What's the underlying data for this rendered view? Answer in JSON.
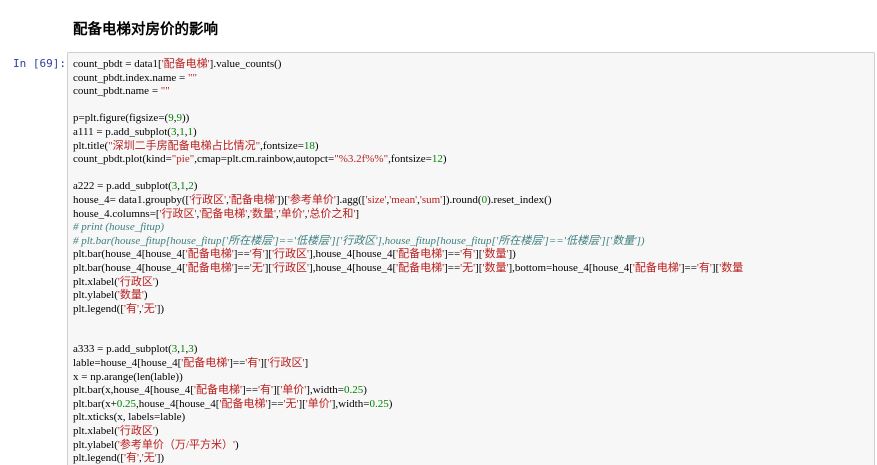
{
  "heading": "配备电梯对房价的影响",
  "cell": {
    "prompt": "In  [69]:",
    "lines": [
      [
        [
          "count_pbdt = data1[",
          ""
        ],
        [
          "'配备电梯'",
          "s"
        ],
        [
          "].value_counts()",
          ""
        ]
      ],
      [
        [
          "count_pbdt.index.name = ",
          ""
        ],
        [
          "\"\"",
          "s"
        ]
      ],
      [
        [
          "count_pbdt.name = ",
          ""
        ],
        [
          "\"\"",
          "s"
        ]
      ],
      [],
      [
        [
          "p=plt.figure(figsize=(",
          ""
        ],
        [
          "9",
          "n"
        ],
        [
          ",",
          ""
        ],
        [
          "9",
          "n"
        ],
        [
          "))",
          ""
        ]
      ],
      [
        [
          "a111 = p.add_subplot(",
          ""
        ],
        [
          "3",
          "n"
        ],
        [
          ",",
          ""
        ],
        [
          "1",
          "n"
        ],
        [
          ",",
          ""
        ],
        [
          "1",
          "n"
        ],
        [
          ")",
          ""
        ]
      ],
      [
        [
          "plt.title(",
          ""
        ],
        [
          "\"深圳二手房配备电梯占比情况\"",
          "s"
        ],
        [
          ",fontsize=",
          ""
        ],
        [
          "18",
          "n"
        ],
        [
          ")",
          ""
        ]
      ],
      [
        [
          "count_pbdt.plot(kind=",
          ""
        ],
        [
          "\"pie\"",
          "s"
        ],
        [
          ",cmap=plt.cm.rainbow,autopct=",
          ""
        ],
        [
          "\"%3.2f%%\"",
          "s"
        ],
        [
          ",fontsize=",
          ""
        ],
        [
          "12",
          "n"
        ],
        [
          ")",
          ""
        ]
      ],
      [],
      [
        [
          "a222 = p.add_subplot(",
          ""
        ],
        [
          "3",
          "n"
        ],
        [
          ",",
          ""
        ],
        [
          "1",
          "n"
        ],
        [
          ",",
          ""
        ],
        [
          "2",
          "n"
        ],
        [
          ")",
          ""
        ]
      ],
      [
        [
          "house_4= data1.groupby([",
          ""
        ],
        [
          "'行政区'",
          "s"
        ],
        [
          ",",
          ""
        ],
        [
          "'配备电梯'",
          "s"
        ],
        [
          "])[",
          ""
        ],
        [
          "'参考单价'",
          "s"
        ],
        [
          "].agg([",
          ""
        ],
        [
          "'size'",
          "s"
        ],
        [
          ",",
          ""
        ],
        [
          "'mean'",
          "s"
        ],
        [
          ",",
          ""
        ],
        [
          "'sum'",
          "s"
        ],
        [
          "]).round(",
          ""
        ],
        [
          "0",
          "n"
        ],
        [
          ").reset_index()",
          ""
        ]
      ],
      [
        [
          "house_4.columns=[",
          ""
        ],
        [
          "'行政区'",
          "s"
        ],
        [
          ",",
          ""
        ],
        [
          "'配备电梯'",
          "s"
        ],
        [
          ",",
          ""
        ],
        [
          "'数量'",
          "s"
        ],
        [
          ",",
          ""
        ],
        [
          "'单价'",
          "s"
        ],
        [
          ",",
          ""
        ],
        [
          "'总价之和'",
          "s"
        ],
        [
          "]",
          ""
        ]
      ],
      [
        [
          "# print (house_fitup)",
          "c"
        ]
      ],
      [
        [
          "# plt.bar(house_fitup[house_fitup['所在楼层']=='低楼层']['行政区'],house_fitup[house_fitup['所在楼层']=='低楼层']['数量'])",
          "c"
        ]
      ],
      [
        [
          "plt.bar(house_4[house_4[",
          ""
        ],
        [
          "'配备电梯'",
          "s"
        ],
        [
          "]==",
          ""
        ],
        [
          "'有'",
          "s"
        ],
        [
          "][",
          ""
        ],
        [
          "'行政区'",
          "s"
        ],
        [
          "],house_4[house_4[",
          ""
        ],
        [
          "'配备电梯'",
          "s"
        ],
        [
          "]==",
          ""
        ],
        [
          "'有'",
          "s"
        ],
        [
          "][",
          ""
        ],
        [
          "'数量'",
          "s"
        ],
        [
          "])",
          ""
        ]
      ],
      [
        [
          "plt.bar(house_4[house_4[",
          ""
        ],
        [
          "'配备电梯'",
          "s"
        ],
        [
          "]==",
          ""
        ],
        [
          "'无'",
          "s"
        ],
        [
          "][",
          ""
        ],
        [
          "'行政区'",
          "s"
        ],
        [
          "],house_4[house_4[",
          ""
        ],
        [
          "'配备电梯'",
          "s"
        ],
        [
          "]==",
          ""
        ],
        [
          "'无'",
          "s"
        ],
        [
          "][",
          ""
        ],
        [
          "'数量'",
          "s"
        ],
        [
          "],bottom=house_4[house_4[",
          ""
        ],
        [
          "'配备电梯'",
          "s"
        ],
        [
          "]==",
          ""
        ],
        [
          "'有'",
          "s"
        ],
        [
          "][",
          ""
        ],
        [
          "'数量",
          "s"
        ]
      ],
      [
        [
          "plt.xlabel(",
          ""
        ],
        [
          "'行政区'",
          "s"
        ],
        [
          ")",
          ""
        ]
      ],
      [
        [
          "plt.ylabel(",
          ""
        ],
        [
          "'数量'",
          "s"
        ],
        [
          ")",
          ""
        ]
      ],
      [
        [
          "plt.legend([",
          ""
        ],
        [
          "'有'",
          "s"
        ],
        [
          ",",
          ""
        ],
        [
          "'无'",
          "s"
        ],
        [
          "])",
          ""
        ]
      ],
      [],
      [],
      [
        [
          "a333 = p.add_subplot(",
          ""
        ],
        [
          "3",
          "n"
        ],
        [
          ",",
          ""
        ],
        [
          "1",
          "n"
        ],
        [
          ",",
          ""
        ],
        [
          "3",
          "n"
        ],
        [
          ")",
          ""
        ]
      ],
      [
        [
          "lable=house_4[house_4[",
          ""
        ],
        [
          "'配备电梯'",
          "s"
        ],
        [
          "]==",
          ""
        ],
        [
          "'有'",
          "s"
        ],
        [
          "][",
          ""
        ],
        [
          "'行政区'",
          "s"
        ],
        [
          "]",
          ""
        ]
      ],
      [
        [
          "x = np.arange(len(lable))",
          ""
        ]
      ],
      [
        [
          "plt.bar(x,house_4[house_4[",
          ""
        ],
        [
          "'配备电梯'",
          "s"
        ],
        [
          "]==",
          ""
        ],
        [
          "'有'",
          "s"
        ],
        [
          "][",
          ""
        ],
        [
          "'单价'",
          "s"
        ],
        [
          "],width=",
          ""
        ],
        [
          "0.25",
          "n"
        ],
        [
          ")",
          ""
        ]
      ],
      [
        [
          "plt.bar(x+",
          ""
        ],
        [
          "0.25",
          "n"
        ],
        [
          ",house_4[house_4[",
          ""
        ],
        [
          "'配备电梯'",
          "s"
        ],
        [
          "]==",
          ""
        ],
        [
          "'无'",
          "s"
        ],
        [
          "][",
          ""
        ],
        [
          "'单价'",
          "s"
        ],
        [
          "],width=",
          ""
        ],
        [
          "0.25",
          "n"
        ],
        [
          ")",
          ""
        ]
      ],
      [
        [
          "plt.xticks(x, labels=lable)",
          ""
        ]
      ],
      [
        [
          "plt.xlabel(",
          ""
        ],
        [
          "'行政区'",
          "s"
        ],
        [
          ")",
          ""
        ]
      ],
      [
        [
          "plt.ylabel(",
          ""
        ],
        [
          "'参考单价（万/平方米）'",
          "s"
        ],
        [
          ")",
          ""
        ]
      ],
      [
        [
          "plt.legend([",
          ""
        ],
        [
          "'有'",
          "s"
        ],
        [
          ",",
          ""
        ],
        [
          "'无'",
          "s"
        ],
        [
          "])",
          ""
        ]
      ]
    ]
  }
}
